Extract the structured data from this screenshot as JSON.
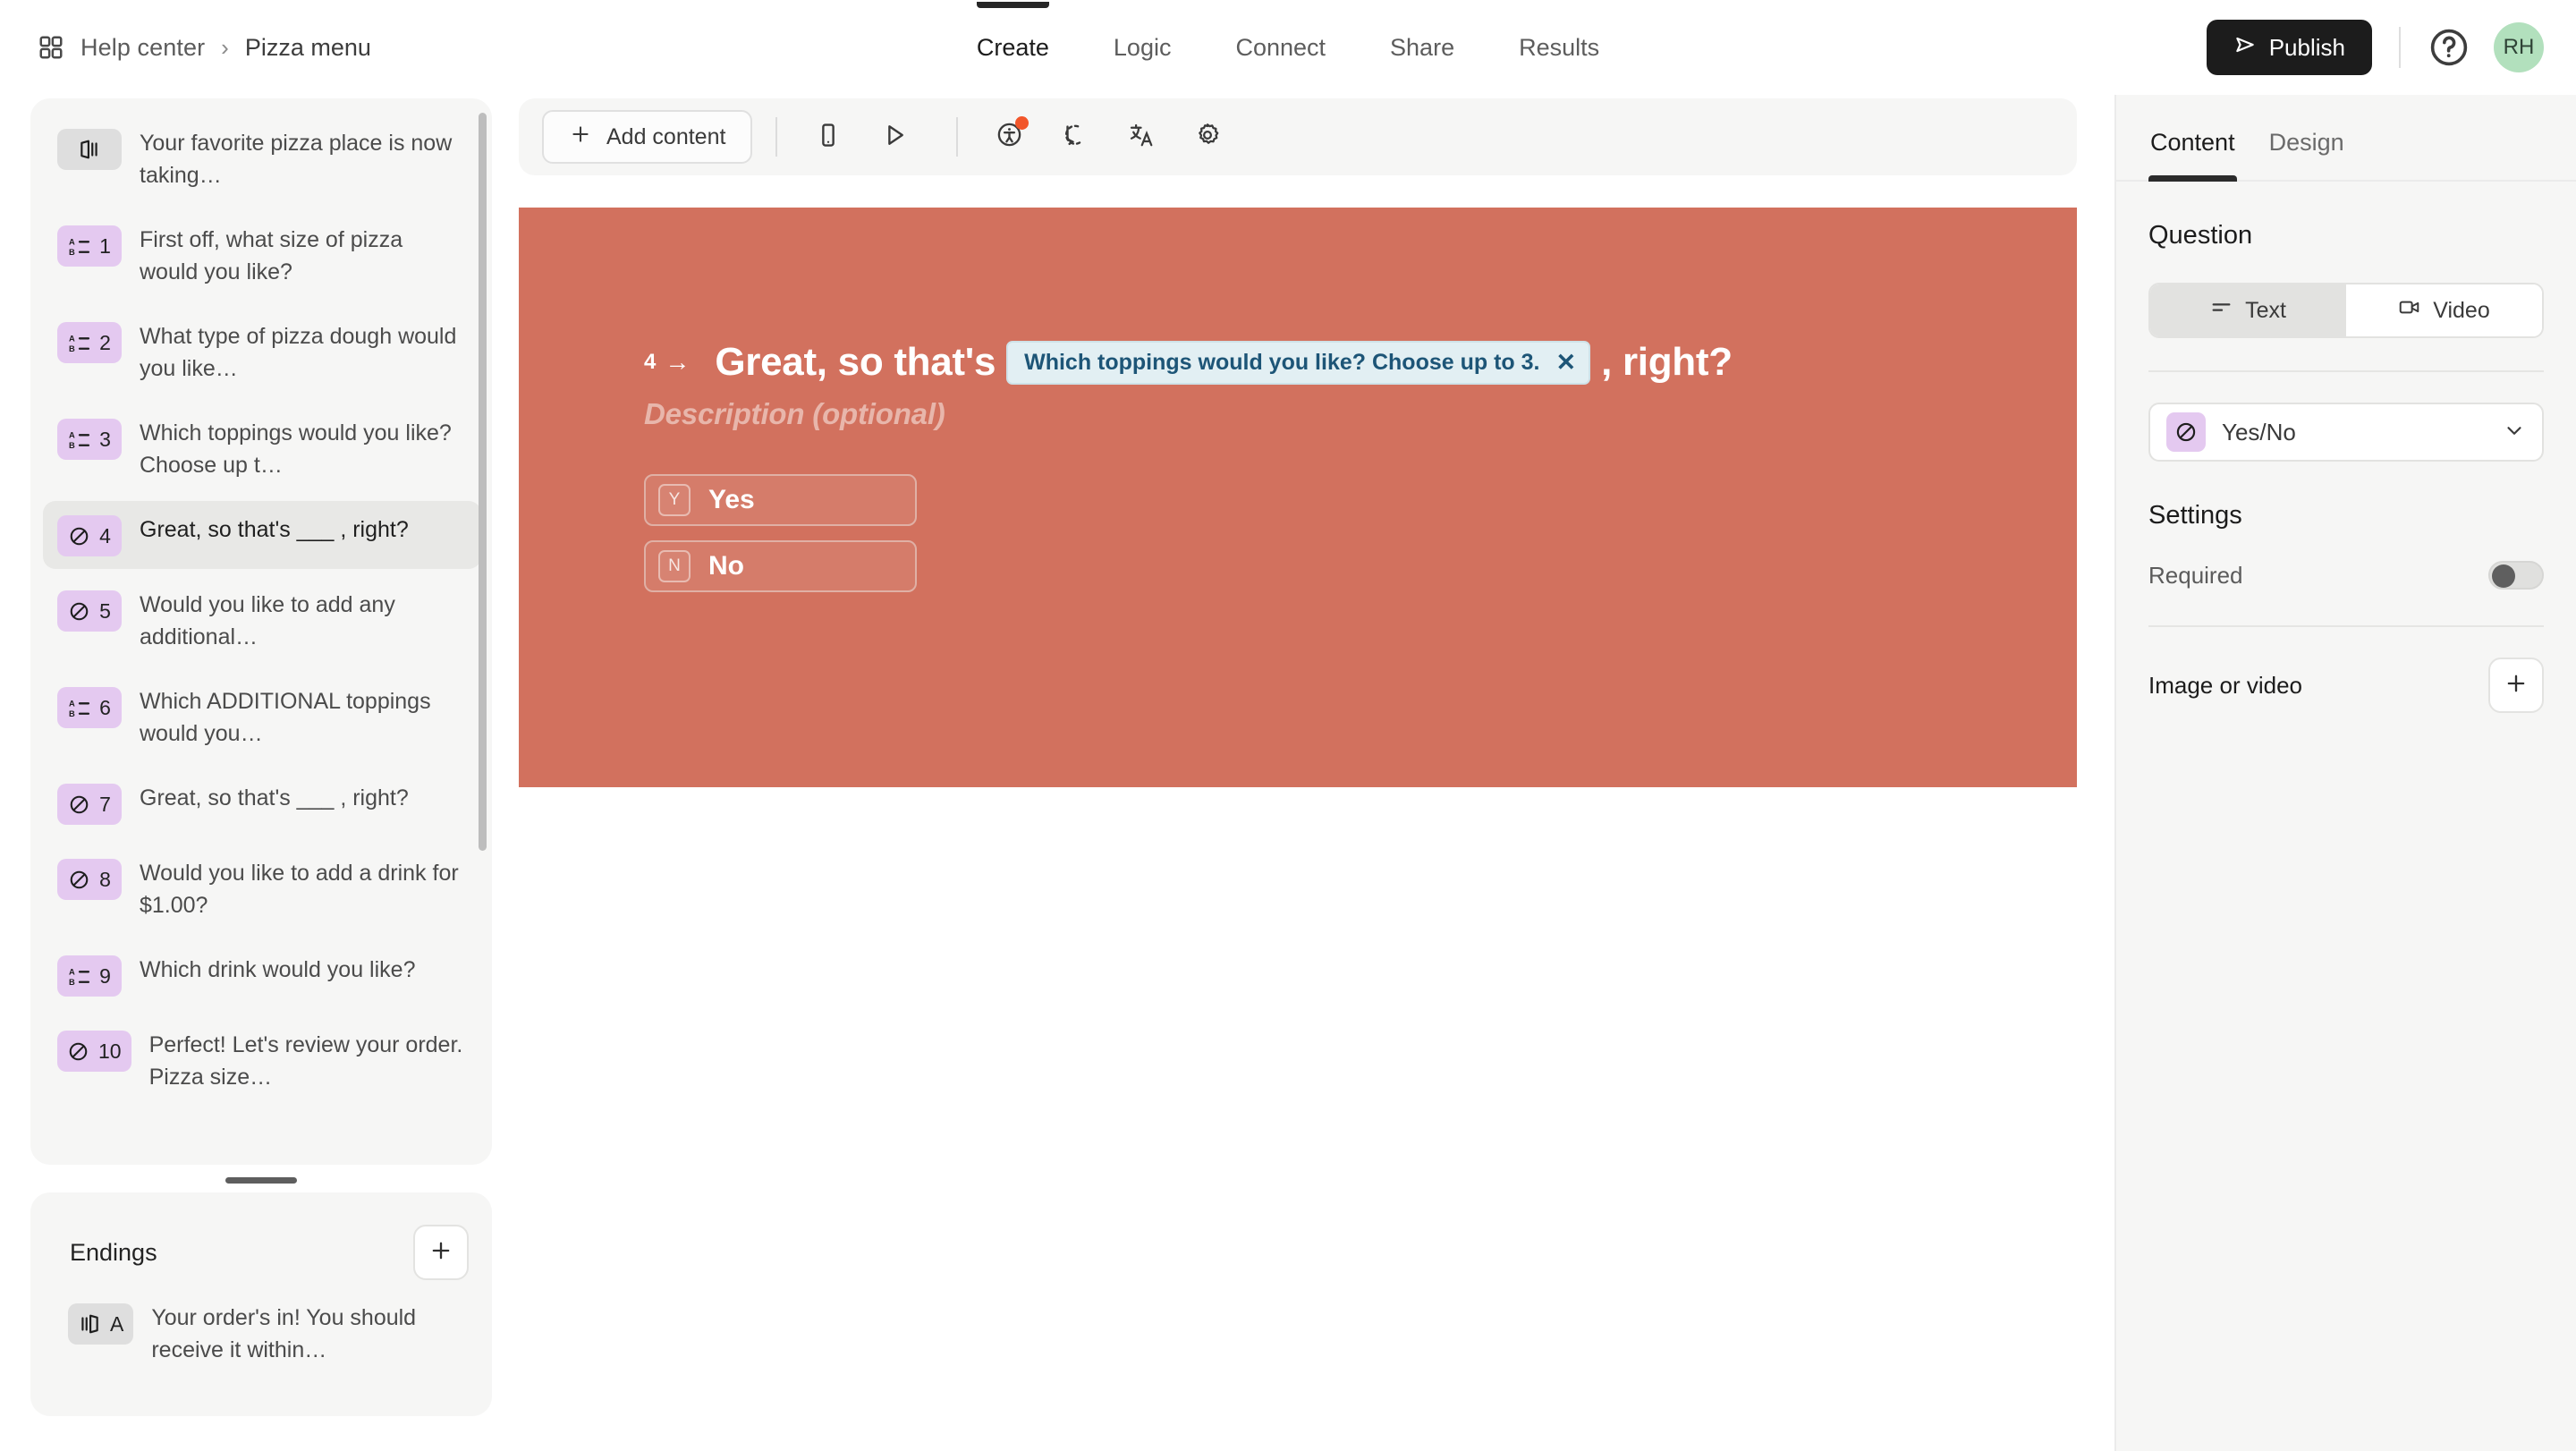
{
  "breadcrumb": {
    "grid_icon": "grid-icon",
    "root": "Help center",
    "separator": "›",
    "current": "Pizza menu"
  },
  "main_tabs": [
    {
      "label": "Create",
      "active": true
    },
    {
      "label": "Logic",
      "active": false
    },
    {
      "label": "Connect",
      "active": false
    },
    {
      "label": "Share",
      "active": false
    },
    {
      "label": "Results",
      "active": false
    }
  ],
  "top_right": {
    "publish_label": "Publish",
    "publish_icon": "send-icon",
    "help_icon": "help-circle-icon",
    "avatar_initials": "RH"
  },
  "toolbar": {
    "add_content_label": "Add content",
    "add_content_icon": "plus-icon",
    "buttons": [
      {
        "name": "mobile-preview-icon",
        "badge": false
      },
      {
        "name": "play-preview-icon",
        "badge": false
      },
      {
        "name": "accessibility-icon",
        "badge": true
      },
      {
        "name": "recall-loop-icon",
        "badge": false
      },
      {
        "name": "translate-icon",
        "badge": false
      },
      {
        "name": "settings-gear-icon",
        "badge": false
      }
    ]
  },
  "sidebar": {
    "questions": [
      {
        "icon": "welcome-screen-icon",
        "badge_type": "neutral",
        "num": "",
        "text": "Your favorite pizza place is now taking…",
        "selected": false
      },
      {
        "icon": "multiple-choice-icon",
        "badge_type": "purple",
        "num": "1",
        "text": "First off, what size of pizza would you like?",
        "selected": false
      },
      {
        "icon": "multiple-choice-icon",
        "badge_type": "purple",
        "num": "2",
        "text": "What type of pizza dough would you like…",
        "selected": false
      },
      {
        "icon": "multiple-choice-icon",
        "badge_type": "purple",
        "num": "3",
        "text": "Which toppings would you like? Choose up t…",
        "selected": false
      },
      {
        "icon": "yes-no-icon",
        "badge_type": "purple",
        "num": "4",
        "text": "Great, so that's ___ , right?",
        "selected": true
      },
      {
        "icon": "yes-no-icon",
        "badge_type": "purple",
        "num": "5",
        "text": "Would you like to add any additional…",
        "selected": false
      },
      {
        "icon": "multiple-choice-icon",
        "badge_type": "purple",
        "num": "6",
        "text": "Which ADDITIONAL toppings would you…",
        "selected": false
      },
      {
        "icon": "yes-no-icon",
        "badge_type": "purple",
        "num": "7",
        "text": "Great, so that's ___ , right?",
        "selected": false
      },
      {
        "icon": "yes-no-icon",
        "badge_type": "purple",
        "num": "8",
        "text": "Would you like to add a drink for $1.00?",
        "selected": false
      },
      {
        "icon": "multiple-choice-icon",
        "badge_type": "purple",
        "num": "9",
        "text": "Which drink would you like?",
        "selected": false
      },
      {
        "icon": "yes-no-icon",
        "badge_type": "purple",
        "num": "10",
        "text": "Perfect! Let's review your order. Pizza size…",
        "selected": false
      }
    ],
    "endings": {
      "title": "Endings",
      "add_icon": "plus-icon",
      "items": [
        {
          "icon": "ending-screen-icon",
          "badge_type": "neutral",
          "num": "A",
          "text": "Your order's in! You should receive it within…"
        }
      ]
    }
  },
  "canvas": {
    "background_color": "#d2715e",
    "question_number": "4",
    "arrow": "→",
    "title_before": "Great, so that's",
    "recall_chip": {
      "label": "Which toppings would you like? Choose up to 3.",
      "remove_icon": "close-x-icon",
      "bg_color": "#e2eff3",
      "text_color": "#1d5577"
    },
    "title_after": ", right?",
    "description_placeholder": "Description (optional)",
    "choices": [
      {
        "key": "Y",
        "label": "Yes"
      },
      {
        "key": "N",
        "label": "No"
      }
    ]
  },
  "right_panel": {
    "tabs": [
      {
        "label": "Content",
        "active": true
      },
      {
        "label": "Design",
        "active": false
      }
    ],
    "question_heading": "Question",
    "media_segment": [
      {
        "label": "Text",
        "icon": "text-lines-icon",
        "active": true
      },
      {
        "label": "Video",
        "icon": "video-camera-icon",
        "active": false
      }
    ],
    "question_type": {
      "icon": "yes-no-icon",
      "label": "Yes/No",
      "chevron": "chevron-down-icon"
    },
    "settings_heading": "Settings",
    "required": {
      "label": "Required",
      "enabled": false
    },
    "image_or_video": {
      "label": "Image or video",
      "add_icon": "plus-icon"
    }
  }
}
